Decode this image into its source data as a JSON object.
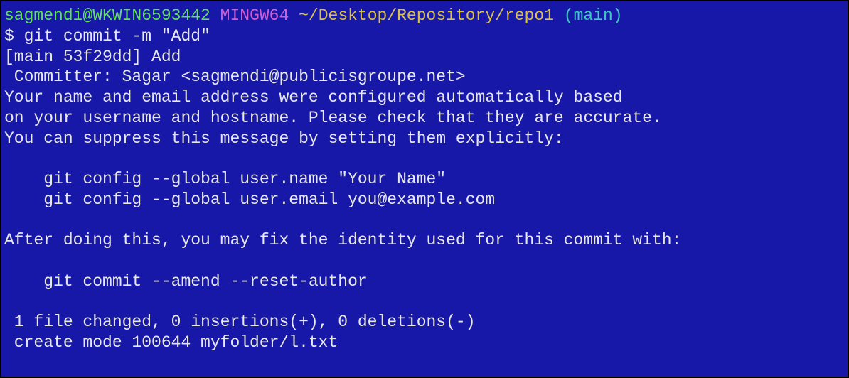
{
  "prompt": {
    "user_host": "sagmendi@WKWIN6593442",
    "mingw": "MINGW64",
    "path": "~/Desktop/Repository/repo1",
    "branch": "(main)"
  },
  "command": {
    "symbol": "$",
    "line": "git commit -m \"Add\""
  },
  "output": {
    "l1": "[main 53f29dd] Add",
    "l2": " Committer: Sagar <sagmendi@publicisgroupe.net>",
    "l3": "Your name and email address were configured automatically based",
    "l4": "on your username and hostname. Please check that they are accurate.",
    "l5": "You can suppress this message by setting them explicitly:",
    "l6": "",
    "l7": "    git config --global user.name \"Your Name\"",
    "l8": "    git config --global user.email you@example.com",
    "l9": "",
    "l10": "After doing this, you may fix the identity used for this commit with:",
    "l11": "",
    "l12": "    git commit --amend --reset-author",
    "l13": "",
    "l14": " 1 file changed, 0 insertions(+), 0 deletions(-)",
    "l15": " create mode 100644 myfolder/l.txt"
  }
}
